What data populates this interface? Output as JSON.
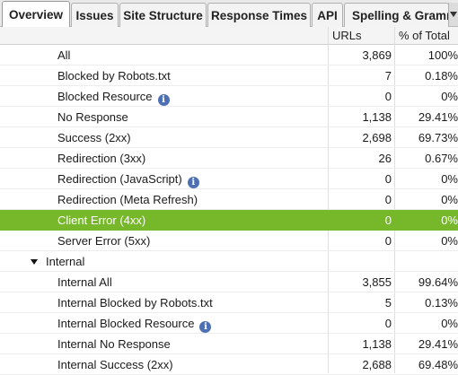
{
  "tabs": [
    {
      "label": "Overview",
      "active": true
    },
    {
      "label": "Issues"
    },
    {
      "label": "Site Structure"
    },
    {
      "label": "Response Times"
    },
    {
      "label": "API"
    },
    {
      "label": "Spelling & Gramm"
    }
  ],
  "columns": {
    "urls": "URLs",
    "percent": "% of Total"
  },
  "rows": [
    {
      "label": "All",
      "urls": "3,869",
      "pct": "100%"
    },
    {
      "label": "Blocked by Robots.txt",
      "urls": "7",
      "pct": "0.18%"
    },
    {
      "label": "Blocked Resource",
      "info_icon": "info-icon",
      "urls": "0",
      "pct": "0%"
    },
    {
      "label": "No Response",
      "urls": "1,138",
      "pct": "29.41%"
    },
    {
      "label": "Success (2xx)",
      "urls": "2,698",
      "pct": "69.73%"
    },
    {
      "label": "Redirection (3xx)",
      "urls": "26",
      "pct": "0.67%"
    },
    {
      "label": "Redirection (JavaScript)",
      "info_icon": "info-icon",
      "urls": "0",
      "pct": "0%"
    },
    {
      "label": "Redirection (Meta Refresh)",
      "urls": "0",
      "pct": "0%"
    },
    {
      "label": "Client Error (4xx)",
      "urls": "0",
      "pct": "0%",
      "selected": true
    },
    {
      "label": "Server Error (5xx)",
      "urls": "0",
      "pct": "0%"
    },
    {
      "label": "Internal",
      "section": true,
      "urls": "",
      "pct": ""
    },
    {
      "label": "Internal All",
      "urls": "3,855",
      "pct": "99.64%"
    },
    {
      "label": "Internal Blocked by Robots.txt",
      "urls": "5",
      "pct": "0.13%"
    },
    {
      "label": "Internal Blocked Resource",
      "info_icon": "info-icon",
      "urls": "0",
      "pct": "0%"
    },
    {
      "label": "Internal No Response",
      "urls": "1,138",
      "pct": "29.41%"
    },
    {
      "label": "Internal Success (2xx)",
      "urls": "2,688",
      "pct": "69.48%"
    }
  ],
  "info_icon_glyph": "i",
  "colors": {
    "selected_row": "#76b82a",
    "info_icon": "#4d6fb3"
  }
}
